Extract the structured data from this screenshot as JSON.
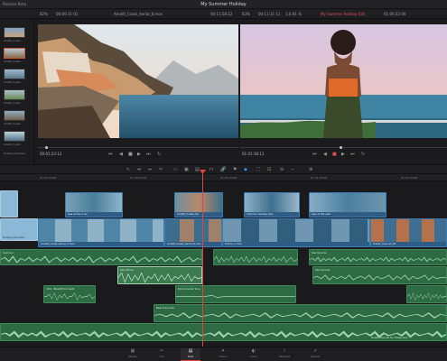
{
  "titlebar": {
    "left": "Resolve Beta",
    "title": "My Summer Holiday"
  },
  "topbar": {
    "zoom_left": "62%",
    "tc_left": "00:00:11:01",
    "clip_name": "Amalfi_Coast_Aerial_8.mov",
    "tc_mid": "00:11:58:12",
    "zoom_right": "63%",
    "tc_right": "00:11:11:11",
    "ratio": "1:0.81 %",
    "timeline_name": "My Summer Holiday 030",
    "tc_far": "01:00:22:00"
  },
  "media_pool": {
    "items": [
      "Amalfi_Coast…",
      "Amalfi_Coast…",
      "Amalfi_Coast…",
      "Amalfi_Coast…",
      "Amalfi_Coast…",
      "Amalfi_Coast…",
      "Amalfi_Coast…",
      "Holiday Mountain"
    ]
  },
  "source_viewer": {
    "timecode": "00:01:23:12"
  },
  "program_viewer": {
    "timecode": "01:01:18:11"
  },
  "ruler": {
    "ticks": [
      "01:00:00:00",
      "01:00:30:00",
      "01:01:00:00",
      "01:01:30:00",
      "01:02:00:00"
    ]
  },
  "timeline": {
    "video_top": [
      {
        "label": "Sea at the river"
      },
      {
        "label": "Amalfi_Coast_Dis"
      },
      {
        "label": "Summer holiday size"
      },
      {
        "label": "Sea at the wall"
      }
    ],
    "video_main": [
      {
        "label": "Holiday Mountain"
      },
      {
        "label": "Amalfi_Coast_Aerial_3.mov"
      },
      {
        "label": "Amalfi_Coast_Aerial_8.mov"
      },
      {
        "label": "Frame_1.mov"
      },
      {
        "label": "Trailer_Cannell_Ot"
      }
    ],
    "audio": [
      {
        "label": "Summer"
      },
      {
        "label": ""
      },
      {
        "label": "Sea Sounds"
      },
      {
        "label": "Sea Atmos"
      },
      {
        "label": "VO - 001"
      },
      {
        "label": "Sea Sounds"
      },
      {
        "label": "VO4 - Beachfront walk"
      },
      {
        "label": "Drone Aerial Tone"
      },
      {
        "label": ""
      },
      {
        "label": "Beach Sounds"
      },
      {
        "label": "Beach Sounds"
      },
      {
        "label": "Ocean Sounds for Trailer.wav"
      }
    ]
  },
  "pages": [
    {
      "label": "Media",
      "icon": "media-icon"
    },
    {
      "label": "Cut",
      "icon": "cut-icon"
    },
    {
      "label": "Edit",
      "icon": "edit-icon",
      "active": true
    },
    {
      "label": "Fusion",
      "icon": "fusion-icon"
    },
    {
      "label": "Color",
      "icon": "color-icon"
    },
    {
      "label": "Fairlight",
      "icon": "fairlight-icon"
    },
    {
      "label": "Deliver",
      "icon": "deliver-icon"
    }
  ],
  "colors": {
    "accent": "#e4443e",
    "video_clip": "#2d5d86",
    "audio_clip": "#2e6a44"
  }
}
